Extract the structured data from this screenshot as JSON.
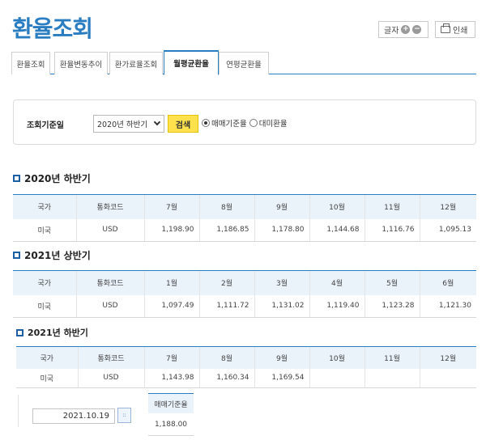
{
  "page_title": "환율조회",
  "toolbar": {
    "font_size_label": "글자",
    "font_plus": "+",
    "font_minus": "−",
    "print_label": "인쇄"
  },
  "tabs": [
    {
      "label": "환율조회",
      "active": false
    },
    {
      "label": "환율변동추이",
      "active": false
    },
    {
      "label": "환가료율조회",
      "active": false
    },
    {
      "label": "월평균환율",
      "active": true
    },
    {
      "label": "연평균환율",
      "active": false
    }
  ],
  "search": {
    "label": "조회기준일",
    "period_value": "2020년 하반기",
    "button_label": "검색",
    "radio_options": [
      {
        "label": "매매기준율",
        "checked": true
      },
      {
        "label": "대미환율",
        "checked": false
      }
    ]
  },
  "column_labels": {
    "country": "국가",
    "currency_code": "통화코드"
  },
  "sections": [
    {
      "title": "2020년 하반기",
      "months": [
        "7월",
        "8월",
        "9월",
        "10월",
        "11월",
        "12월"
      ],
      "rows": [
        {
          "country": "미국",
          "code": "USD",
          "values": [
            "1,198.90",
            "1,186.85",
            "1,178.80",
            "1,144.68",
            "1,116.76",
            "1,095.13"
          ]
        }
      ]
    },
    {
      "title": "2021년 상반기",
      "months": [
        "1월",
        "2월",
        "3월",
        "4월",
        "5월",
        "6월"
      ],
      "rows": [
        {
          "country": "미국",
          "code": "USD",
          "values": [
            "1,097.49",
            "1,111.72",
            "1,131.02",
            "1,119.40",
            "1,123.28",
            "1,121.30"
          ]
        }
      ]
    },
    {
      "title": "2021년 하반기",
      "months": [
        "7월",
        "8월",
        "9월",
        "10월",
        "11월",
        "12월"
      ],
      "rows": [
        {
          "country": "미국",
          "code": "USD",
          "values": [
            "1,143.98",
            "1,160.34",
            "1,169.54",
            "",
            "",
            ""
          ]
        }
      ]
    }
  ],
  "rate_lookup": {
    "date": "2021.10.19",
    "calendar_icon": "::",
    "column_label": "매매기준율",
    "value": "1,188.00"
  },
  "colors": {
    "accent": "#2b7dc2",
    "header_bg": "#eaf2fa",
    "search_button": "#ffe14d"
  }
}
